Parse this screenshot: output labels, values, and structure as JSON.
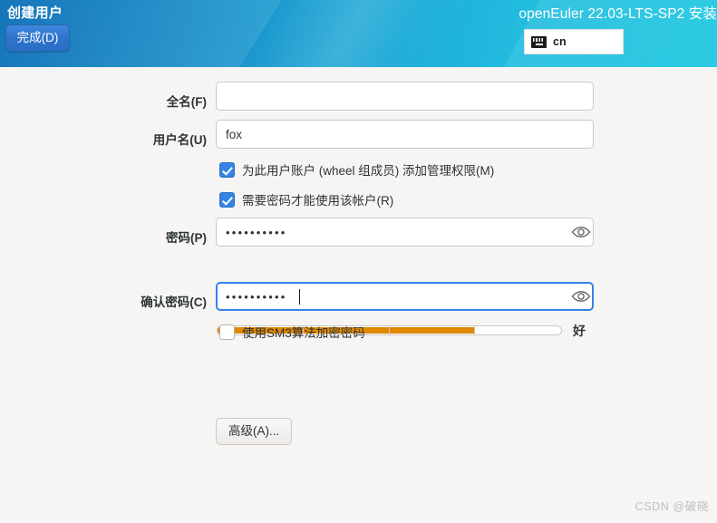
{
  "header": {
    "page_title": "创建用户",
    "done_label": "完成(D)",
    "install_title": "openEuler 22.03-LTS-SP2 安装",
    "keyboard_layout": "cn",
    "keyboard_icon": "keyboard-icon",
    "gradient_from": "#1273b9",
    "gradient_to": "#2ccbe3",
    "done_button_color": "#2e74cd"
  },
  "form": {
    "fullname": {
      "label": "全名(F)",
      "value": "",
      "placeholder": ""
    },
    "username": {
      "label": "用户名(U)",
      "value": "fox",
      "placeholder": ""
    },
    "admin_checkbox": {
      "label": "为此用户账户 (wheel 组成员) 添加管理权限(M)",
      "checked": true
    },
    "require_password_checkbox": {
      "label": "需要密码才能使用该帐户(R)",
      "checked": true
    },
    "password": {
      "label": "密码(P)",
      "value": "••••••••••",
      "reveal_icon": "eye-icon"
    },
    "confirm_password": {
      "label": "确认密码(C)",
      "value": "••••••••••",
      "reveal_icon": "eye-icon",
      "focused": true
    },
    "sm3_checkbox": {
      "label": "使用SM3算法加密密码",
      "checked": false
    },
    "advanced_button": {
      "label": "高级(A)..."
    }
  },
  "password_strength": {
    "label": "好",
    "segments": 4,
    "filled_segments": 3,
    "fill_color": "#e08700",
    "percent": 75
  },
  "watermark": {
    "text": "CSDN @破晓"
  }
}
